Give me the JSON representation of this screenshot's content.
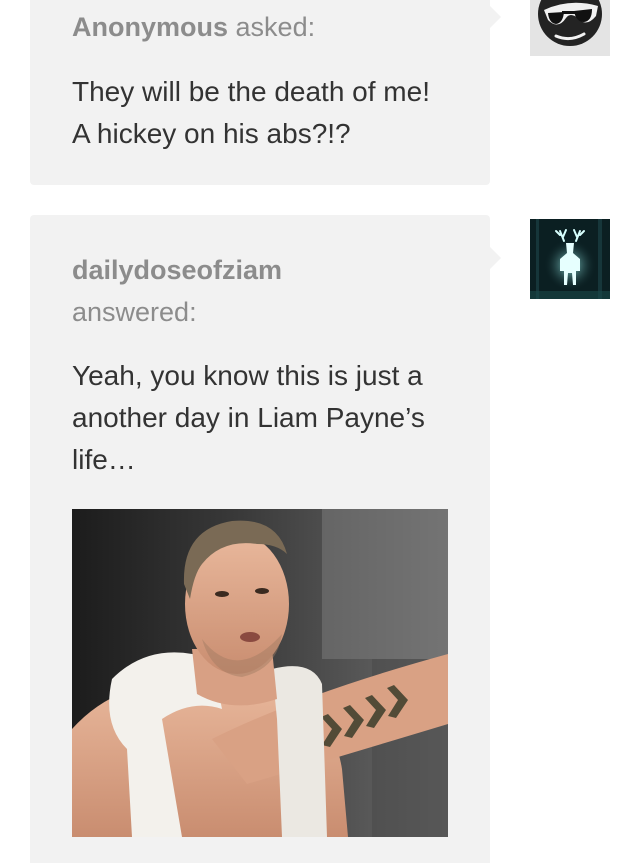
{
  "ask": {
    "asker": "Anonymous",
    "verb": "asked:",
    "question": "They will be the death of me! A hickey on his abs?!?"
  },
  "answer": {
    "answerer": "dailydoseofziam",
    "verb": "answered:",
    "text": "Yeah, you know this is just a another day in Liam Payne’s life…",
    "image_icon": "gif-photo"
  },
  "avatars": {
    "anonymous": "sunglasses-face-icon",
    "blog": "glowing-stag-icon"
  },
  "colors": {
    "bubble_bg": "#f2f2f2",
    "meta_text": "#8c8c8c",
    "body_text": "#333333"
  }
}
